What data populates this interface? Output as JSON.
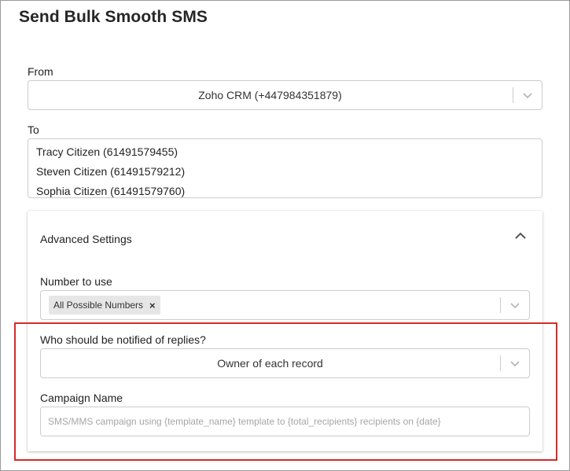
{
  "title": "Send Bulk Smooth SMS",
  "from": {
    "label": "From",
    "value": "Zoho CRM (+447984351879)"
  },
  "to": {
    "label": "To",
    "recipients": [
      "Tracy Citizen (61491579455)",
      "Steven Citizen (61491579212)",
      "Sophia Citizen (61491579760)"
    ]
  },
  "advanced": {
    "title": "Advanced Settings",
    "number_to_use": {
      "label": "Number to use",
      "tag": "All Possible Numbers",
      "tag_remove": "×"
    },
    "notify": {
      "label": "Who should be notified of replies?",
      "value": "Owner of each record"
    },
    "campaign": {
      "label": "Campaign Name",
      "placeholder": "SMS/MMS campaign using {template_name} template to {total_recipients} recipients on {date}"
    }
  },
  "colors": {
    "highlight": "#d72a2a",
    "border": "#cccccc"
  }
}
